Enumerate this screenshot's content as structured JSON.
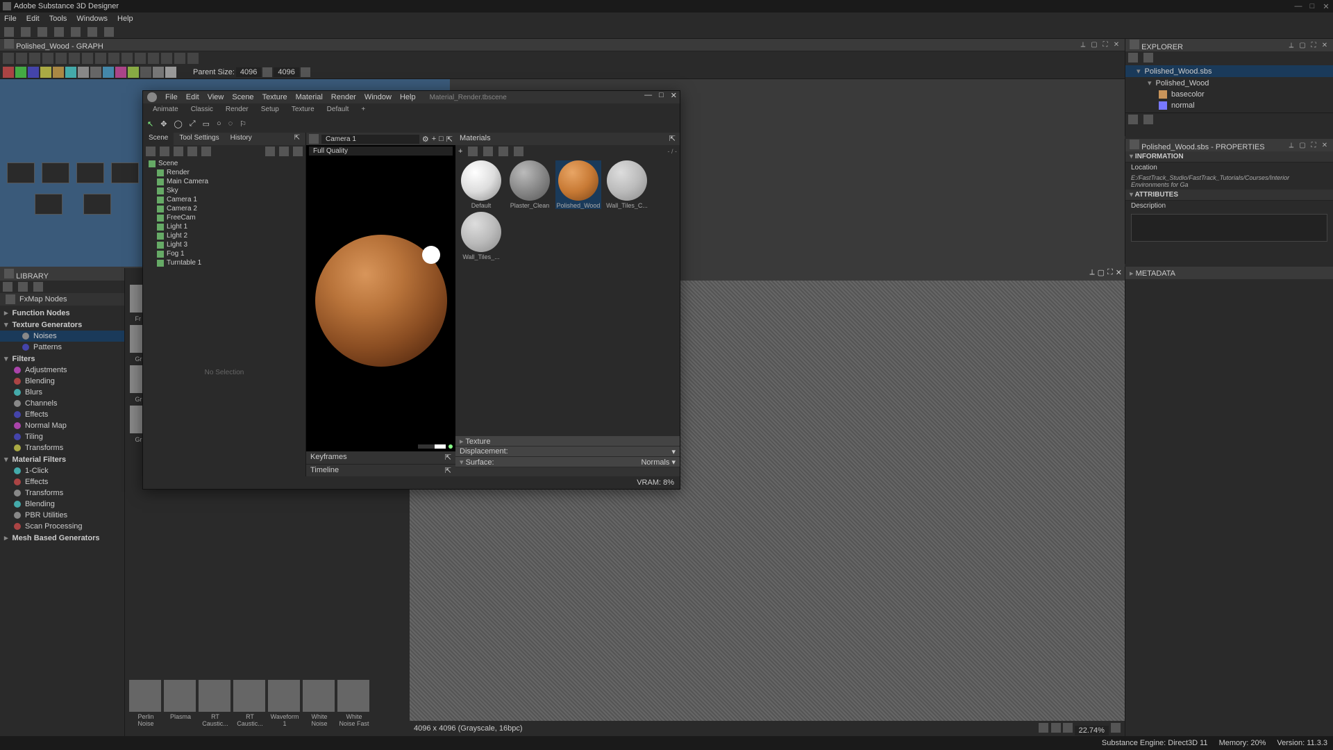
{
  "app": {
    "title": "Adobe Substance 3D Designer"
  },
  "menu": [
    "File",
    "Edit",
    "Tools",
    "Windows",
    "Help"
  ],
  "graph": {
    "title": "Polished_Wood - GRAPH",
    "parentSizeLabel": "Parent Size:",
    "size1": "4096",
    "size2": "4096"
  },
  "library": {
    "title": "LIBRARY",
    "fxmap": "FxMap Nodes",
    "items": [
      {
        "label": "Function Nodes",
        "type": "cat"
      },
      {
        "label": "Texture Generators",
        "type": "cat",
        "open": true
      },
      {
        "label": "Noises",
        "type": "sub2",
        "selected": true
      },
      {
        "label": "Patterns",
        "type": "sub2"
      },
      {
        "label": "Filters",
        "type": "cat",
        "open": true
      },
      {
        "label": "Adjustments",
        "type": "sub"
      },
      {
        "label": "Blending",
        "type": "sub"
      },
      {
        "label": "Blurs",
        "type": "sub"
      },
      {
        "label": "Channels",
        "type": "sub"
      },
      {
        "label": "Effects",
        "type": "sub"
      },
      {
        "label": "Normal Map",
        "type": "sub"
      },
      {
        "label": "Tiling",
        "type": "sub"
      },
      {
        "label": "Transforms",
        "type": "sub"
      },
      {
        "label": "Material Filters",
        "type": "cat",
        "open": true
      },
      {
        "label": "1-Click",
        "type": "sub"
      },
      {
        "label": "Effects",
        "type": "sub"
      },
      {
        "label": "Transforms",
        "type": "sub"
      },
      {
        "label": "Blending",
        "type": "sub"
      },
      {
        "label": "PBR Utilities",
        "type": "sub"
      },
      {
        "label": "Scan Processing",
        "type": "sub"
      },
      {
        "label": "Mesh Based Generators",
        "type": "cat"
      }
    ],
    "noises": [
      {
        "label": "Perlin Noise"
      },
      {
        "label": "Plasma"
      },
      {
        "label": "RT Caustic..."
      },
      {
        "label": "RT Caustic..."
      },
      {
        "label": "Waveform 1"
      },
      {
        "label": "White Noise"
      },
      {
        "label": "White Noise Fast"
      }
    ],
    "thumbLabels": [
      "Fr Sur",
      "Gr Ma",
      "Gr Ma",
      "Gr Ma"
    ]
  },
  "marmoset": {
    "menu": [
      "File",
      "Edit",
      "View",
      "Scene",
      "Texture",
      "Material",
      "Render",
      "Window",
      "Help"
    ],
    "currentFile": "Material_Render.tbscene",
    "tabs": [
      "Animate",
      "Classic",
      "Render",
      "Setup",
      "Texture",
      "Default",
      "+"
    ],
    "sceneTabs": [
      "Scene",
      "Tool Settings",
      "History"
    ],
    "camera": "Camera 1",
    "quality": "Full Quality",
    "tree": [
      "Scene",
      "Render",
      "Main Camera",
      "Sky",
      "Camera 1",
      "Camera 2",
      "FreeCam",
      "Light 1",
      "Light 2",
      "Light 3",
      "Fog 1",
      "Turntable 1"
    ],
    "noSelection": "No Selection",
    "materialsTitle": "Materials",
    "materialCount": "- / -",
    "materials": [
      {
        "name": "Default",
        "cls": "white"
      },
      {
        "name": "Plaster_Clean",
        "cls": "gray"
      },
      {
        "name": "Polished_Wood",
        "cls": "wood",
        "selected": true
      },
      {
        "name": "Wall_Tiles_C...",
        "cls": "tile"
      },
      {
        "name": "Wall_Tiles_...",
        "cls": "tile"
      }
    ],
    "keyframes": "Keyframes",
    "timeline": "Timeline",
    "texture": "Texture",
    "displacement": "Displacement:",
    "surface": "Surface:",
    "surfaceVal": "Normals ▾",
    "vram": "VRAM: 8%"
  },
  "explorer": {
    "title": "EXPLORER",
    "items": [
      {
        "label": "Polished_Wood.sbs",
        "lv": 1,
        "selected": true
      },
      {
        "label": "Polished_Wood",
        "lv": 2
      },
      {
        "label": "basecolor",
        "lv": 3,
        "sw": "#c8945a"
      },
      {
        "label": "normal",
        "lv": 3,
        "sw": "#7878ff"
      }
    ]
  },
  "properties": {
    "title": "Polished_Wood.sbs - PROPERTIES",
    "info": "INFORMATION",
    "locationLabel": "Location",
    "locationVal": "E:/FastTrack_Studio/FastTrack_Tutorials/Courses/Interior Environments for Ga",
    "attributes": "ATTRIBUTES",
    "description": "Description"
  },
  "metadata": {
    "title": "METADATA"
  },
  "preview2d": {
    "info": "4096 x 4096 (Grayscale, 16bpc)",
    "zoom": "22.74%"
  },
  "status": {
    "engine": "Substance Engine: Direct3D 11",
    "memory": "Memory: 20%",
    "version": "Version: 11.3.3"
  }
}
